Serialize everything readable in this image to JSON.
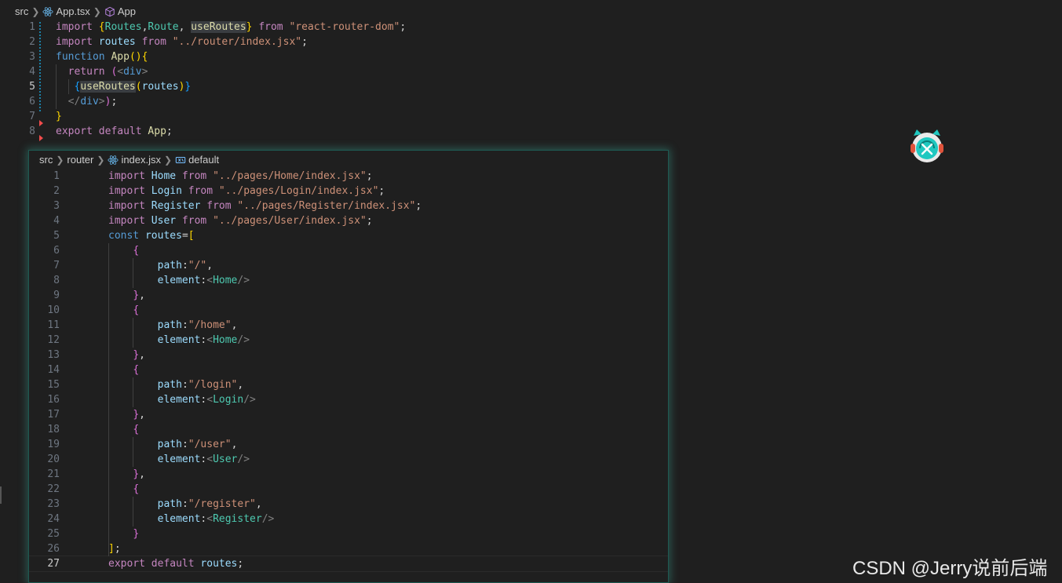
{
  "top_editor": {
    "breadcrumb": {
      "folder": "src",
      "file": "App.tsx",
      "symbol": "App",
      "file_icon": "react-icon",
      "symbol_icon": "cube-icon"
    },
    "active_line": 5,
    "lines": [
      {
        "n": "1",
        "tokens": [
          [
            "kw",
            "import "
          ],
          [
            "b1",
            "{"
          ],
          [
            "ty",
            "Routes"
          ],
          [
            "df",
            ","
          ],
          [
            "ty",
            "Route"
          ],
          [
            "df",
            ", "
          ],
          [
            "fn hl",
            "useRoutes"
          ],
          [
            "b1",
            "}"
          ],
          [
            "kw",
            " from "
          ],
          [
            "st",
            "\"react-router-dom\""
          ],
          [
            "df",
            ";"
          ]
        ]
      },
      {
        "n": "2",
        "tokens": [
          [
            "kw",
            "import "
          ],
          [
            "vr",
            "routes"
          ],
          [
            "kw",
            " from "
          ],
          [
            "st",
            "\"../router/index.jsx\""
          ],
          [
            "df",
            ";"
          ]
        ]
      },
      {
        "n": "3",
        "tokens": [
          [
            "bl",
            "function "
          ],
          [
            "fn",
            "App"
          ],
          [
            "b1",
            "()"
          ],
          [
            "b1",
            "{"
          ]
        ]
      },
      {
        "n": "4",
        "tokens": [
          [
            "kw",
            "  return "
          ],
          [
            "b2",
            "("
          ],
          [
            "pg",
            "<"
          ],
          [
            "bl",
            "div"
          ],
          [
            "pg",
            ">"
          ]
        ]
      },
      {
        "n": "5",
        "tokens": [
          [
            "df",
            "   "
          ],
          [
            "b3",
            "{"
          ],
          [
            "fn hl",
            "useRoutes"
          ],
          [
            "b1",
            "("
          ],
          [
            "vr",
            "routes"
          ],
          [
            "b1",
            ")"
          ],
          [
            "b3",
            "}"
          ]
        ]
      },
      {
        "n": "6",
        "tokens": [
          [
            "df",
            "  "
          ],
          [
            "pg",
            "</"
          ],
          [
            "bl",
            "div"
          ],
          [
            "pg",
            ">"
          ],
          [
            "b2",
            ")"
          ],
          [
            "df",
            ";"
          ]
        ]
      },
      {
        "n": "7",
        "tokens": [
          [
            "b1",
            "}"
          ]
        ]
      },
      {
        "n": "8",
        "tokens": [
          [
            "kw",
            "export "
          ],
          [
            "kw",
            "default "
          ],
          [
            "fn",
            "App"
          ],
          [
            "df",
            ";"
          ]
        ]
      }
    ]
  },
  "peek_editor": {
    "breadcrumb": {
      "folder": "src",
      "subfolder": "router",
      "file": "index.jsx",
      "symbol": "default",
      "file_icon": "react-icon",
      "symbol_icon": "variable-icon"
    },
    "active_line": 27,
    "lines": [
      {
        "n": "1",
        "tokens": [
          [
            "kw",
            "import "
          ],
          [
            "vr",
            "Home"
          ],
          [
            "kw",
            " from "
          ],
          [
            "st",
            "\"../pages/Home/index.jsx\""
          ],
          [
            "df",
            ";"
          ]
        ]
      },
      {
        "n": "2",
        "tokens": [
          [
            "kw",
            "import "
          ],
          [
            "vr",
            "Login"
          ],
          [
            "kw",
            " from "
          ],
          [
            "st",
            "\"../pages/Login/index.jsx\""
          ],
          [
            "df",
            ";"
          ]
        ]
      },
      {
        "n": "3",
        "tokens": [
          [
            "kw",
            "import "
          ],
          [
            "vr",
            "Register"
          ],
          [
            "kw",
            " from "
          ],
          [
            "st",
            "\"../pages/Register/index.jsx\""
          ],
          [
            "df",
            ";"
          ]
        ]
      },
      {
        "n": "4",
        "tokens": [
          [
            "kw",
            "import "
          ],
          [
            "vr",
            "User"
          ],
          [
            "kw",
            " from "
          ],
          [
            "st",
            "\"../pages/User/index.jsx\""
          ],
          [
            "df",
            ";"
          ]
        ]
      },
      {
        "n": "5",
        "tokens": [
          [
            "bl",
            "const "
          ],
          [
            "vr",
            "routes"
          ],
          [
            "df",
            "="
          ],
          [
            "b1",
            "["
          ]
        ]
      },
      {
        "n": "6",
        "tokens": [
          [
            "df",
            "    "
          ],
          [
            "b2",
            "{"
          ]
        ]
      },
      {
        "n": "7",
        "tokens": [
          [
            "df",
            "        "
          ],
          [
            "prop",
            "path"
          ],
          [
            "df",
            ":"
          ],
          [
            "st",
            "\"/\""
          ],
          [
            "df",
            ","
          ]
        ]
      },
      {
        "n": "8",
        "tokens": [
          [
            "df",
            "        "
          ],
          [
            "prop",
            "element"
          ],
          [
            "df",
            ":"
          ],
          [
            "pg",
            "<"
          ],
          [
            "ty",
            "Home"
          ],
          [
            "pg",
            "/>"
          ]
        ]
      },
      {
        "n": "9",
        "tokens": [
          [
            "df",
            "    "
          ],
          [
            "b2",
            "}"
          ],
          [
            "df",
            ","
          ]
        ]
      },
      {
        "n": "10",
        "tokens": [
          [
            "df",
            "    "
          ],
          [
            "b2",
            "{"
          ]
        ]
      },
      {
        "n": "11",
        "tokens": [
          [
            "df",
            "        "
          ],
          [
            "prop",
            "path"
          ],
          [
            "df",
            ":"
          ],
          [
            "st",
            "\"/home\""
          ],
          [
            "df",
            ","
          ]
        ]
      },
      {
        "n": "12",
        "tokens": [
          [
            "df",
            "        "
          ],
          [
            "prop",
            "element"
          ],
          [
            "df",
            ":"
          ],
          [
            "pg",
            "<"
          ],
          [
            "ty",
            "Home"
          ],
          [
            "pg",
            "/>"
          ]
        ]
      },
      {
        "n": "13",
        "tokens": [
          [
            "df",
            "    "
          ],
          [
            "b2",
            "}"
          ],
          [
            "df",
            ","
          ]
        ]
      },
      {
        "n": "14",
        "tokens": [
          [
            "df",
            "    "
          ],
          [
            "b2",
            "{"
          ]
        ]
      },
      {
        "n": "15",
        "tokens": [
          [
            "df",
            "        "
          ],
          [
            "prop",
            "path"
          ],
          [
            "df",
            ":"
          ],
          [
            "st",
            "\"/login\""
          ],
          [
            "df",
            ","
          ]
        ]
      },
      {
        "n": "16",
        "tokens": [
          [
            "df",
            "        "
          ],
          [
            "prop",
            "element"
          ],
          [
            "df",
            ":"
          ],
          [
            "pg",
            "<"
          ],
          [
            "ty",
            "Login"
          ],
          [
            "pg",
            "/>"
          ]
        ]
      },
      {
        "n": "17",
        "tokens": [
          [
            "df",
            "    "
          ],
          [
            "b2",
            "}"
          ],
          [
            "df",
            ","
          ]
        ]
      },
      {
        "n": "18",
        "tokens": [
          [
            "df",
            "    "
          ],
          [
            "b2",
            "{"
          ]
        ]
      },
      {
        "n": "19",
        "tokens": [
          [
            "df",
            "        "
          ],
          [
            "prop",
            "path"
          ],
          [
            "df",
            ":"
          ],
          [
            "st",
            "\"/user\""
          ],
          [
            "df",
            ","
          ]
        ]
      },
      {
        "n": "20",
        "tokens": [
          [
            "df",
            "        "
          ],
          [
            "prop",
            "element"
          ],
          [
            "df",
            ":"
          ],
          [
            "pg",
            "<"
          ],
          [
            "ty",
            "User"
          ],
          [
            "pg",
            "/>"
          ]
        ]
      },
      {
        "n": "21",
        "tokens": [
          [
            "df",
            "    "
          ],
          [
            "b2",
            "}"
          ],
          [
            "df",
            ","
          ]
        ]
      },
      {
        "n": "22",
        "tokens": [
          [
            "df",
            "    "
          ],
          [
            "b2",
            "{"
          ]
        ]
      },
      {
        "n": "23",
        "tokens": [
          [
            "df",
            "        "
          ],
          [
            "prop",
            "path"
          ],
          [
            "df",
            ":"
          ],
          [
            "st",
            "\"/register\""
          ],
          [
            "df",
            ","
          ]
        ]
      },
      {
        "n": "24",
        "tokens": [
          [
            "df",
            "        "
          ],
          [
            "prop",
            "element"
          ],
          [
            "df",
            ":"
          ],
          [
            "pg",
            "<"
          ],
          [
            "ty",
            "Register"
          ],
          [
            "pg",
            "/>"
          ]
        ]
      },
      {
        "n": "25",
        "tokens": [
          [
            "df",
            "    "
          ],
          [
            "b2",
            "}"
          ]
        ]
      },
      {
        "n": "26",
        "tokens": [
          [
            "b1",
            "]"
          ],
          [
            "df",
            ";"
          ]
        ]
      },
      {
        "n": "27",
        "tokens": [
          [
            "kw",
            "export "
          ],
          [
            "kw",
            "default "
          ],
          [
            "vr",
            "routes"
          ],
          [
            "df",
            ";"
          ]
        ]
      }
    ]
  },
  "watermark": "CSDN @Jerry说前后端",
  "mascot_icon": "cat-mascot-icon",
  "colors": {
    "background": "#1f1f1f",
    "peek_border": "#40beaa",
    "keyword": "#c586c0",
    "string": "#ce9178",
    "type": "#4ec9b0",
    "variable": "#9cdcfe",
    "function": "#dcdcaa"
  }
}
